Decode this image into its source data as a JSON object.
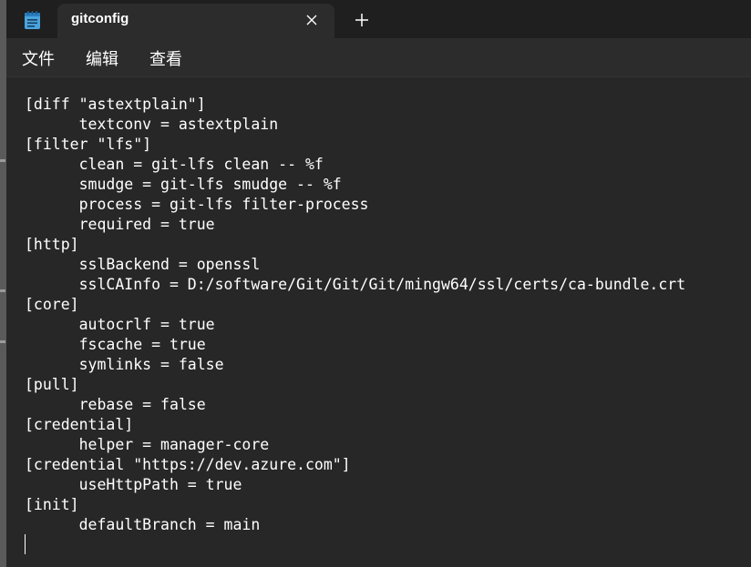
{
  "window": {
    "app_icon": "notepad-icon",
    "tab_title": "gitconfig",
    "tab_close_icon": "close-icon",
    "new_tab_icon": "plus-icon"
  },
  "menu": {
    "file": "文件",
    "edit": "编辑",
    "view": "查看"
  },
  "editor": {
    "content": "[diff \"astextplain\"]\n      textconv = astextplain\n[filter \"lfs\"]\n      clean = git-lfs clean -- %f\n      smudge = git-lfs smudge -- %f\n      process = git-lfs filter-process\n      required = true\n[http]\n      sslBackend = openssl\n      sslCAInfo = D:/software/Git/Git/Git/mingw64/ssl/certs/ca-bundle.crt\n[core]\n      autocrlf = true\n      fscache = true\n      symlinks = false\n[pull]\n      rebase = false\n[credential]\n      helper = manager-core\n[credential \"https://dev.azure.com\"]\n      useHttpPath = true\n[init]\n      defaultBranch = main"
  },
  "colors": {
    "background": "#272727",
    "titlebar": "#1f1f1f",
    "tab": "#2c2c2c",
    "text": "#ffffff",
    "icon_accent": "#4aa3df"
  }
}
